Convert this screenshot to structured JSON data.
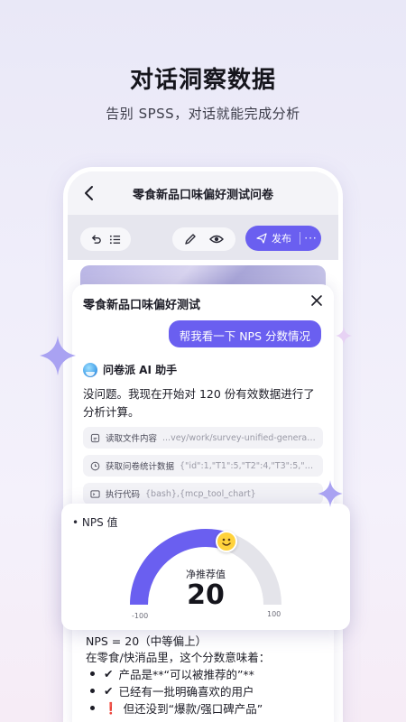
{
  "hero": {
    "title": "对话洞察数据",
    "subtitle": "告别 SPSS，对话就能完成分析"
  },
  "phone": {
    "title": "零食新品口味偏好测试问卷",
    "toolbar": {
      "undo_icon": "undo-icon",
      "list_icon": "list-icon",
      "edit_icon": "pencil-icon",
      "preview_icon": "eye-icon",
      "publish_label": "发布",
      "more_label": "···"
    }
  },
  "sheet": {
    "title": "零食新品口味偏好测试",
    "user_message": "帮我看一下 NPS 分数情况",
    "assistant_name": "问卷派 AI 助手",
    "reply": "没问题。我现在开始对 120 份有效数据进行了分析计算。",
    "steps": [
      {
        "label": "读取文件内容",
        "detail": "...vey/work/survey-unified-generate.md",
        "icon": "file-icon"
      },
      {
        "label": "获取问卷统计数据",
        "detail": "{\"id\":1,\"T1\":5,\"T2\":4,\"T3\":5,\"T4\":5,...",
        "icon": "clock-icon"
      },
      {
        "label": "执行代码",
        "detail": "{bash},{mcp_tool_chart}",
        "icon": "terminal-icon"
      }
    ]
  },
  "nps_card": {
    "heading": "NPS 值",
    "label": "净推荐值",
    "value": "20",
    "min_label": "-100",
    "max_label": "100"
  },
  "chart_data": {
    "type": "gauge",
    "title": "NPS 值",
    "value": 20,
    "range": [
      -100,
      100
    ],
    "colors": {
      "fill": "#6a5ff0",
      "track": "#e4e4ea",
      "indicator": "#ffd23c"
    }
  },
  "result": {
    "line1": "NPS = 20（中等偏上）",
    "line2": "在零食/快消品里，这个分数意味着：",
    "bullets": [
      {
        "mark": "✔",
        "text": "产品是**“可以被推荐的”**"
      },
      {
        "mark": "✔",
        "text": "已经有一批明确喜欢的用户"
      },
      {
        "mark": "❗",
        "text": "但还没到“爆款/强口碑产品”"
      }
    ]
  },
  "colors": {
    "accent": "#6a5ff0",
    "background": "#efedf9"
  }
}
